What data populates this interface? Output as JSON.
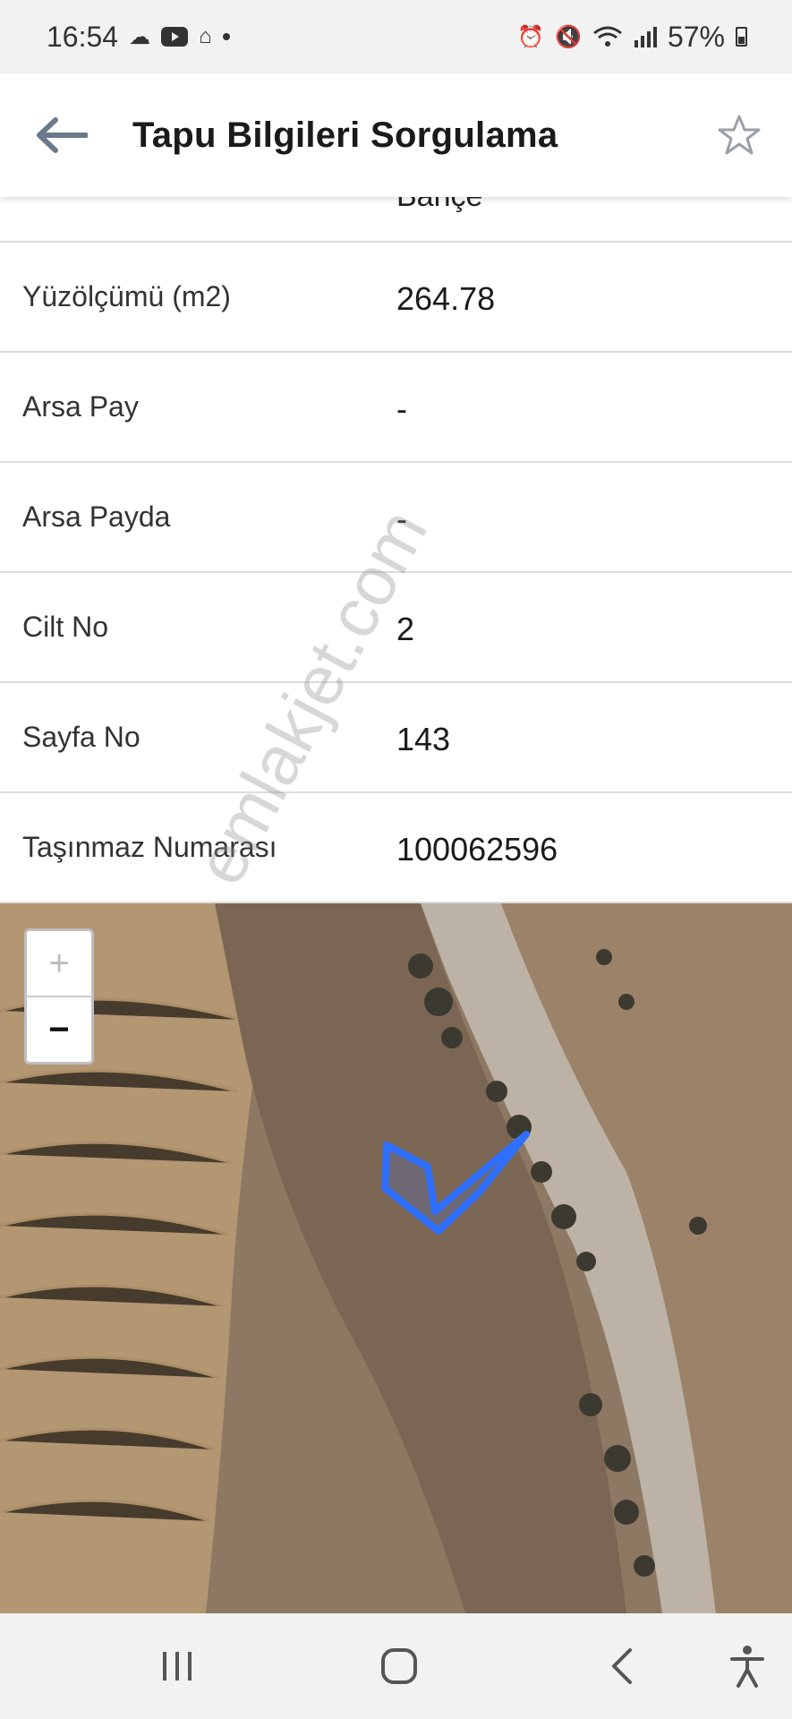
{
  "status_bar": {
    "time": "16:54",
    "battery_text": "57%",
    "left_icons": [
      "cloud-icon",
      "youtube-icon",
      "notification-icon"
    ],
    "right_icons": [
      "alarm-icon",
      "mute-icon",
      "wifi-icon",
      "signal-icon",
      "battery-icon"
    ]
  },
  "app_bar": {
    "title": "Tapu Bilgileri Sorgulama",
    "back_icon": "arrow-left-icon",
    "favorite_icon": "star-outline-icon"
  },
  "partial_row_value": "Bahçe",
  "rows": [
    {
      "label": "Yüzölçümü (m2)",
      "value": "264.78"
    },
    {
      "label": "Arsa Pay",
      "value": "-"
    },
    {
      "label": "Arsa Payda",
      "value": "-"
    },
    {
      "label": "Cilt No",
      "value": "2"
    },
    {
      "label": "Sayfa No",
      "value": "143"
    },
    {
      "label": "Taşınmaz Numarası",
      "value": "100062596"
    }
  ],
  "map": {
    "zoom_in": "+",
    "zoom_out": "−",
    "parcel_color": "#2f6fff"
  },
  "watermark": "emlakjet.com",
  "nav_bar": {
    "icons": [
      "recent-apps-icon",
      "home-icon",
      "back-icon",
      "accessibility-icon"
    ]
  }
}
